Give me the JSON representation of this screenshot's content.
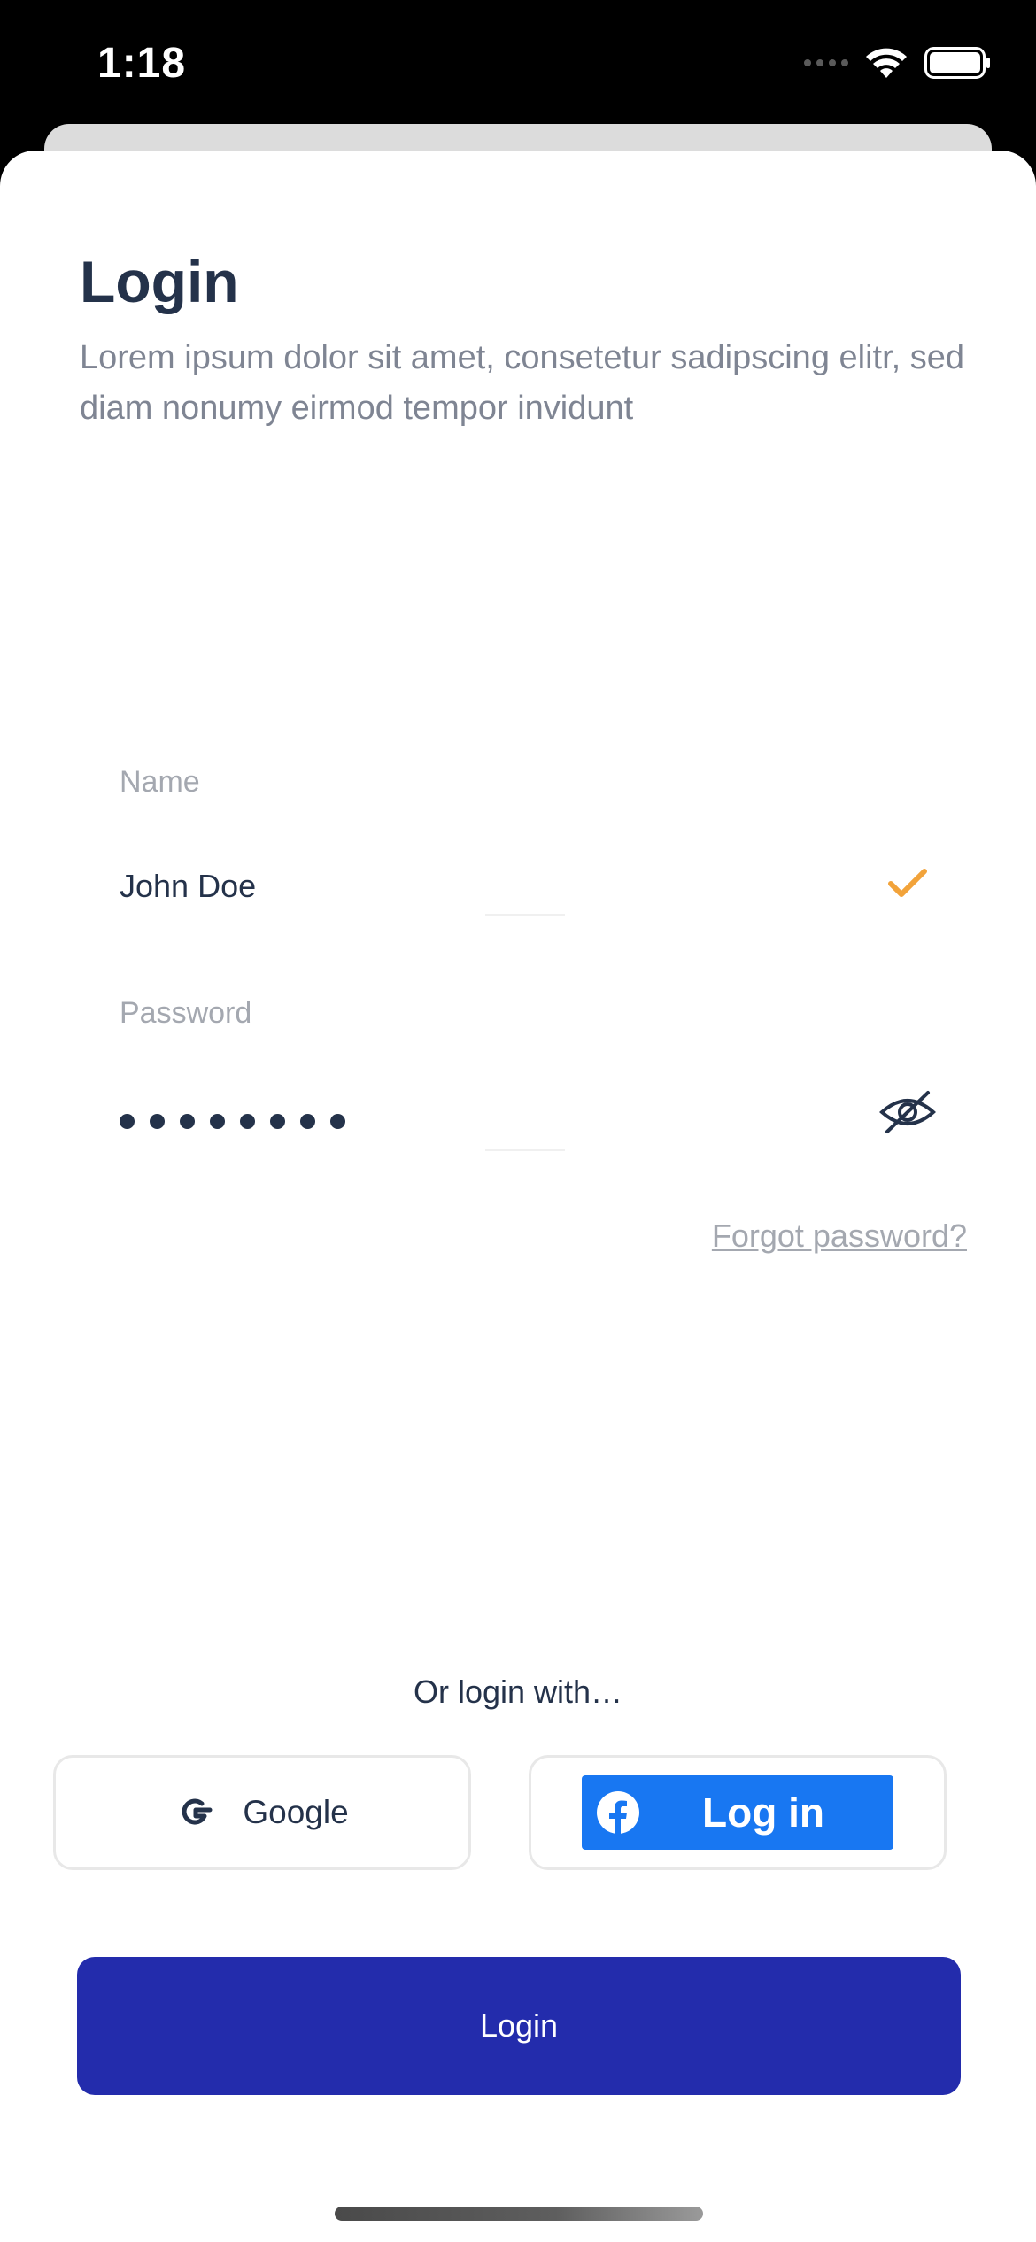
{
  "status_bar": {
    "time": "1:18"
  },
  "header": {
    "title": "Login",
    "subtitle": "Lorem ipsum dolor sit amet, consetetur sadipscing elitr, sed diam nonumy eirmod tempor invidunt"
  },
  "form": {
    "name_label": "Name",
    "name_value": "John Doe",
    "name_valid": true,
    "password_label": "Password",
    "password_masked_length": 8,
    "forgot_link": "Forgot password?"
  },
  "social": {
    "divider_text": "Or login with…",
    "google_label": "Google",
    "facebook_label": "Log in"
  },
  "actions": {
    "login_label": "Login"
  },
  "colors": {
    "primary": "#232cac",
    "title": "#24324a",
    "muted": "#a4a8b0",
    "check": "#f2a33a",
    "facebook": "#1877f2"
  },
  "icons": [
    "wifi-icon",
    "battery-icon",
    "check-icon",
    "eye-off-icon",
    "google-icon",
    "facebook-icon"
  ]
}
